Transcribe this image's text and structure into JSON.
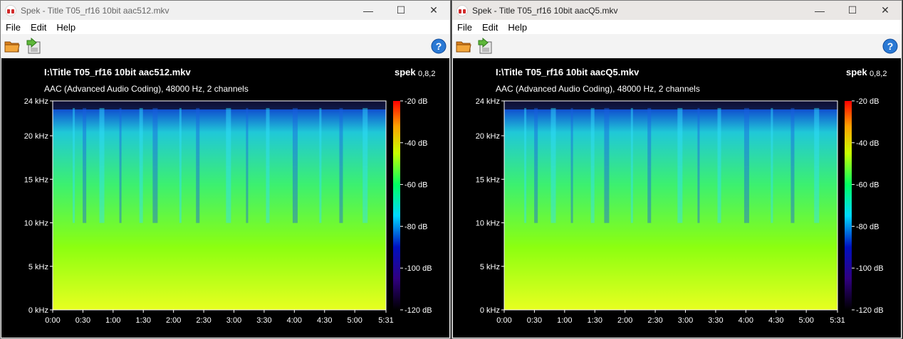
{
  "windows": [
    {
      "title": "Spek - Title T05_rf16 10bit aac512.mkv",
      "menu": [
        "File",
        "Edit",
        "Help"
      ],
      "file_path": "I:\\Title T05_rf16 10bit aac512.mkv",
      "brand": "spek",
      "version": "0,8,2",
      "stream_info": "AAC (Advanced Audio Coding), 48000 Hz, 2 channels",
      "window_buttons": {
        "minimize": "—",
        "maximize": "☐",
        "close": "✕"
      }
    },
    {
      "title": "Spek - Title T05_rf16 10bit aacQ5.mkv",
      "menu": [
        "File",
        "Edit",
        "Help"
      ],
      "file_path": "I:\\Title T05_rf16 10bit aacQ5.mkv",
      "brand": "spek",
      "version": "0,8,2",
      "stream_info": "AAC (Advanced Audio Coding), 48000 Hz, 2 channels",
      "window_buttons": {
        "minimize": "—",
        "maximize": "☐",
        "close": "✕"
      }
    }
  ],
  "toolbar_icons": [
    "open-folder-icon",
    "save-icon",
    "help-icon"
  ],
  "chart_data": {
    "type": "heatmap",
    "y_axis": {
      "label": "frequency",
      "ticks": [
        "0 kHz",
        "5 kHz",
        "10 kHz",
        "15 kHz",
        "20 kHz",
        "24 kHz"
      ],
      "range_khz": [
        0,
        24
      ]
    },
    "x_axis": {
      "ticks": [
        "0:00",
        "0:30",
        "1:00",
        "1:30",
        "2:00",
        "2:30",
        "3:00",
        "3:30",
        "4:00",
        "4:30",
        "5:00",
        "5:31"
      ],
      "range_seconds": [
        0,
        331
      ]
    },
    "color_scale": {
      "ticks": [
        "-20 dB",
        "-40 dB",
        "-60 dB",
        "-80 dB",
        "-100 dB",
        "-120 dB"
      ],
      "range_db": [
        -120,
        -20
      ]
    },
    "colors": {
      "high": "#ff0000",
      "mid": "#5bff00",
      "low_mid": "#00d8ff",
      "low": "#0010c0",
      "floor": "#000000"
    }
  }
}
